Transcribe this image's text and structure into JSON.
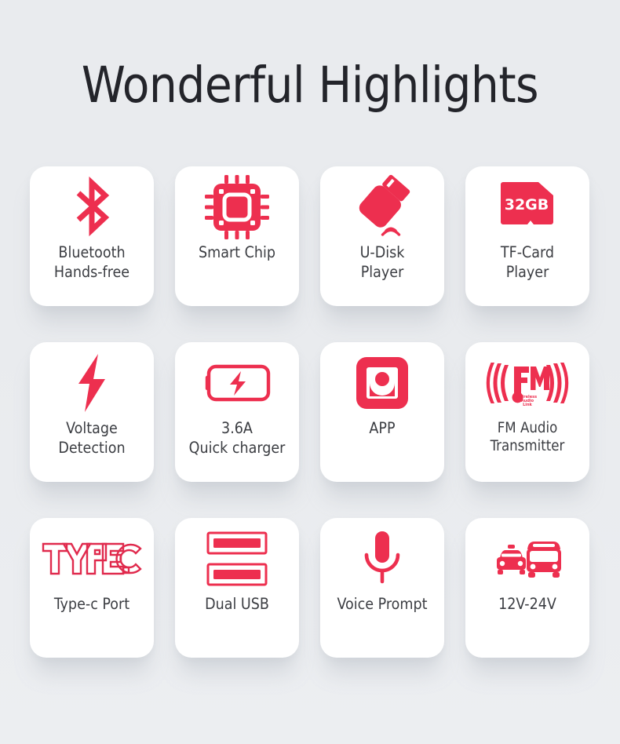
{
  "page": {
    "title": "Wonderful Highlights",
    "background_color": "#e9ebee",
    "accent_color": "#ed2f4f",
    "card_background": "#ffffff",
    "label_color": "#3b3d42"
  },
  "features": [
    {
      "id": "bluetooth-hands-free",
      "icon": "bluetooth-icon",
      "label": "Bluetooth\nHands-free"
    },
    {
      "id": "smart-chip",
      "icon": "chip-icon",
      "label": "Smart Chip"
    },
    {
      "id": "u-disk-player",
      "icon": "usb-drive-icon",
      "label": "U-Disk\nPlayer"
    },
    {
      "id": "tf-card-player",
      "icon": "microsd-card-icon",
      "label": "TF-Card\nPlayer",
      "badge": "32GB"
    },
    {
      "id": "voltage-detection",
      "icon": "lightning-bolt-icon",
      "label": "Voltage\nDetection"
    },
    {
      "id": "quick-charger",
      "icon": "battery-bolt-icon",
      "label": "3.6A\nQuick charger"
    },
    {
      "id": "app",
      "icon": "app-icon",
      "label": "APP"
    },
    {
      "id": "fm-audio-transmitter",
      "icon": "fm-radio-icon",
      "label": "FM Audio\nTransmitter",
      "logo_text": "FM",
      "logo_subtext": "Wireless Audio Link"
    },
    {
      "id": "type-c-port",
      "icon": "type-c-logo-icon",
      "label": "Type-c Port",
      "logo_text": "TYPE-C"
    },
    {
      "id": "dual-usb",
      "icon": "dual-usb-icon",
      "label": "Dual USB"
    },
    {
      "id": "voice-prompt",
      "icon": "microphone-icon",
      "label": "Voice Prompt"
    },
    {
      "id": "voltage-range",
      "icon": "car-bus-icon",
      "label": "12V-24V"
    }
  ]
}
